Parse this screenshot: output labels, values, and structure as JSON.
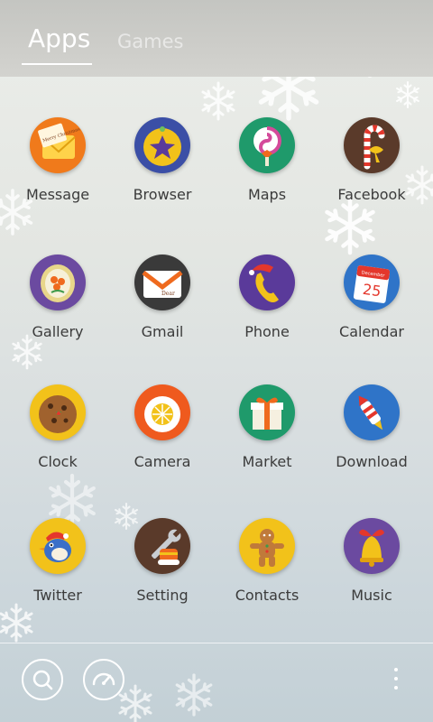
{
  "header": {
    "tabs": [
      {
        "label": "Apps",
        "active": true
      },
      {
        "label": "Games",
        "active": false
      }
    ]
  },
  "apps": [
    {
      "label": "Message",
      "icon": "message-envelope-icon",
      "color": "#f07a1b"
    },
    {
      "label": "Browser",
      "icon": "browser-star-icon",
      "color": "#3b4fa6"
    },
    {
      "label": "Maps",
      "icon": "maps-lollipop-icon",
      "color": "#1f9a6b"
    },
    {
      "label": "Facebook",
      "icon": "facebook-candy-cane-icon",
      "color": "#5a3a2a"
    },
    {
      "label": "Gallery",
      "icon": "gallery-frame-icon",
      "color": "#6b4aa0"
    },
    {
      "label": "Gmail",
      "icon": "gmail-envelope-icon",
      "color": "#3a3a3a"
    },
    {
      "label": "Phone",
      "icon": "phone-handset-icon",
      "color": "#5a3a9a"
    },
    {
      "label": "Calendar",
      "icon": "calendar-icon",
      "color": "#2f74c8"
    },
    {
      "label": "Clock",
      "icon": "clock-cookie-icon",
      "color": "#f2c21a"
    },
    {
      "label": "Camera",
      "icon": "camera-orange-icon",
      "color": "#ef5a1e"
    },
    {
      "label": "Market",
      "icon": "market-gift-icon",
      "color": "#1f9a6b"
    },
    {
      "label": "Download",
      "icon": "download-rocket-icon",
      "color": "#2f74c8"
    },
    {
      "label": "Twitter",
      "icon": "twitter-bird-icon",
      "color": "#f2c21a"
    },
    {
      "label": "Setting",
      "icon": "setting-wrench-icon",
      "color": "#5a3a2a"
    },
    {
      "label": "Contacts",
      "icon": "contacts-gingerbread-icon",
      "color": "#f2c21a"
    },
    {
      "label": "Music",
      "icon": "music-bell-icon",
      "color": "#6b4aa0"
    }
  ],
  "calendar_icon": {
    "month": "December",
    "day": "25"
  },
  "gmail_icon": {
    "text": "Dear"
  },
  "message_icon": {
    "text": "Merry Christmas"
  },
  "dock": {
    "search": "search-icon",
    "speed": "speedometer-icon",
    "menu": "more-vert-icon"
  }
}
